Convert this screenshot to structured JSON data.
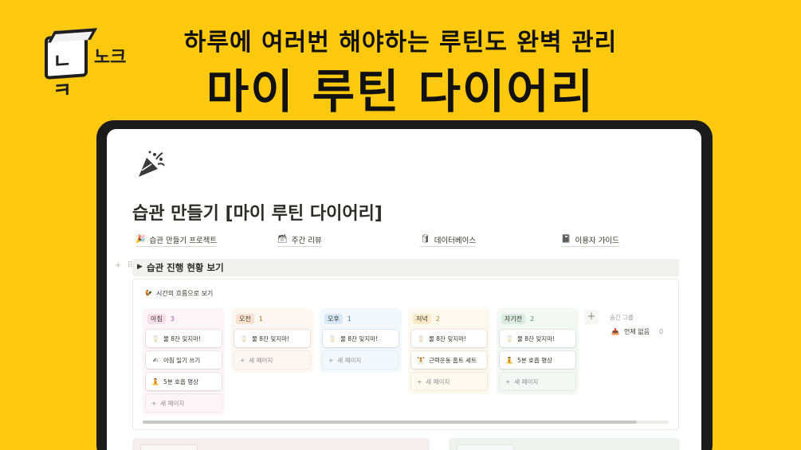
{
  "brand": {
    "logo_glyph": "ㄴㅋ",
    "logo_text": "노크"
  },
  "banner": {
    "tagline": "하루에 여러번 해야하는 루틴도 완벽 관리",
    "headline": "마이 루틴 다이어리"
  },
  "page": {
    "icon": "party-popper-icon",
    "title": "습관 만들기 [마이 루틴 다이어리]"
  },
  "links": [
    {
      "icon": "🎉",
      "label": "습관 만들기 프로젝트"
    },
    {
      "icon": "🗃",
      "label": "주간 리뷰"
    },
    {
      "icon": "🛢",
      "label": "데이터베이스"
    },
    {
      "icon": "📓",
      "label": "이용자 가이드"
    }
  ],
  "toggle": {
    "label": "습관 진행 현황 보기"
  },
  "board": {
    "view_icon": "🐓",
    "view_title": "시간의 흐름으로 보기",
    "new_page_label": "새 페이지",
    "hidden_group_label": "숨긴 그룹",
    "hidden_group": {
      "icon": "📥",
      "label": "언제 없음",
      "count": "0"
    },
    "columns": [
      {
        "label": "아침",
        "count": "3",
        "bg": "#fdf5f8",
        "tag_bg": "#f7dde7",
        "count_color": "#c14c8a",
        "cards": [
          {
            "icon": "🥛",
            "text": "물 8잔 잊지마!"
          },
          {
            "icon": "✍",
            "text": "아침 일기 쓰기"
          },
          {
            "icon": "🧘",
            "text": "5분 호흡 명상"
          }
        ]
      },
      {
        "label": "오전",
        "count": "1",
        "bg": "#fdf6f1",
        "tag_bg": "#f9e1d0",
        "count_color": "#c46a2e",
        "cards": [
          {
            "icon": "🥛",
            "text": "물 8잔 잊지마!"
          }
        ]
      },
      {
        "label": "오후",
        "count": "1",
        "bg": "#f3f8fc",
        "tag_bg": "#d6e8f5",
        "count_color": "#3a7cb8",
        "cards": [
          {
            "icon": "🥛",
            "text": "물 8잔 잊지마!"
          }
        ]
      },
      {
        "label": "저녁",
        "count": "2",
        "bg": "#fdf9ef",
        "tag_bg": "#f8ebc7",
        "count_color": "#b58a1c",
        "cards": [
          {
            "icon": "🥛",
            "text": "물 8잔 잊지마!"
          },
          {
            "icon": "🏋",
            "text": "근력운동 홈트 세트"
          }
        ]
      },
      {
        "label": "자기전",
        "count": "2",
        "bg": "#f4f8f5",
        "tag_bg": "#dcebdf",
        "count_color": "#4a8a5c",
        "cards": [
          {
            "icon": "🥛",
            "text": "물 8잔 잊지마!"
          },
          {
            "icon": "🧘",
            "text": "5분 호흡 명상"
          }
        ]
      }
    ]
  },
  "colors": {
    "background": "#fdc90f",
    "device": "#1b1b1b"
  }
}
